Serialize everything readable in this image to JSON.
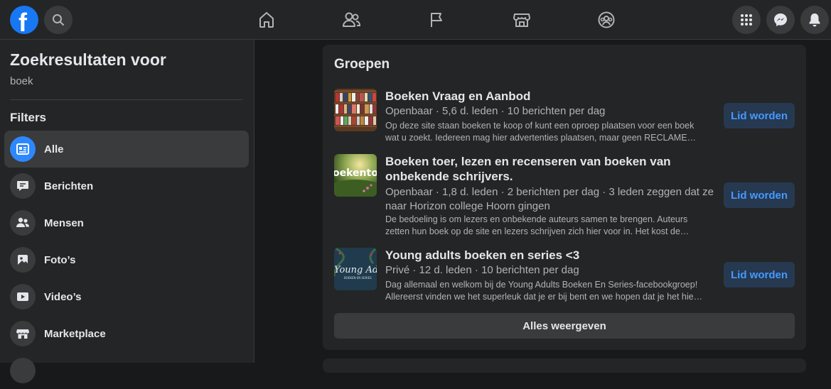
{
  "colors": {
    "brand": "#1877f2",
    "accent": "#2d88ff",
    "join_button_bg": "#263951",
    "join_button_text": "#4599ff"
  },
  "topbar": {
    "logo": "f",
    "icons": [
      "search-icon",
      "home-icon",
      "friends-icon",
      "pages-flag-icon",
      "marketplace-icon",
      "groups-icon",
      "menu-grid-icon",
      "messenger-icon",
      "notifications-icon"
    ]
  },
  "sidebar": {
    "title": "Zoekresultaten voor",
    "query": "boek",
    "filters_label": "Filters",
    "items": [
      {
        "label": "Alle",
        "icon": "all-results-icon",
        "active": true
      },
      {
        "label": "Berichten",
        "icon": "posts-icon",
        "active": false
      },
      {
        "label": "Mensen",
        "icon": "people-icon",
        "active": false
      },
      {
        "label": "Foto’s",
        "icon": "photos-icon",
        "active": false
      },
      {
        "label": "Video’s",
        "icon": "video-icon",
        "active": false
      },
      {
        "label": "Marketplace",
        "icon": "marketplace-icon",
        "active": false
      }
    ]
  },
  "groups_section": {
    "title": "Groepen",
    "join_label": "Lid worden",
    "show_all_label": "Alles weergeven",
    "groups": [
      {
        "name": "Boeken Vraag en Aanbod",
        "meta": "Openbaar · 5,6 d. leden · 10 berichten per dag",
        "desc_line1": "Op deze site staan boeken te koop of kunt een oproep plaatsen voor een boek",
        "desc_line2": "wat u zoekt. Iedereen mag hier advertenties plaatsen, maar geen RECLAME…"
      },
      {
        "name_line1": "Boeken toer, lezen en recenseren van boeken van",
        "name_line2": "onbekende schrijvers.",
        "meta_line1": "Openbaar · 1,8 d. leden · 2 berichten per dag · 3 leden zeggen dat ze",
        "meta_line2": "naar Horizon college Hoorn gingen",
        "desc_line1": "De bedoeling is om lezers en onbekende auteurs samen te brengen. Auteurs",
        "desc_line2": "zetten hun boek op de site en lezers schrijven zich hier voor in. Het kost de…",
        "thumb_text": "oekento"
      },
      {
        "name": "Young adults boeken en series <3",
        "meta": "Privé · 12 d. leden · 10 berichten per dag",
        "desc_line1": "Dag allemaal en welkom bij de Young Adults Boeken En Series-facebookgroep!",
        "desc_line2": "Allereerst vinden we het superleuk dat je er bij bent en we hopen dat je het hie…",
        "thumb_text": "Young Adults",
        "thumb_subtext": "BOEKEN EN SERIES"
      }
    ]
  }
}
